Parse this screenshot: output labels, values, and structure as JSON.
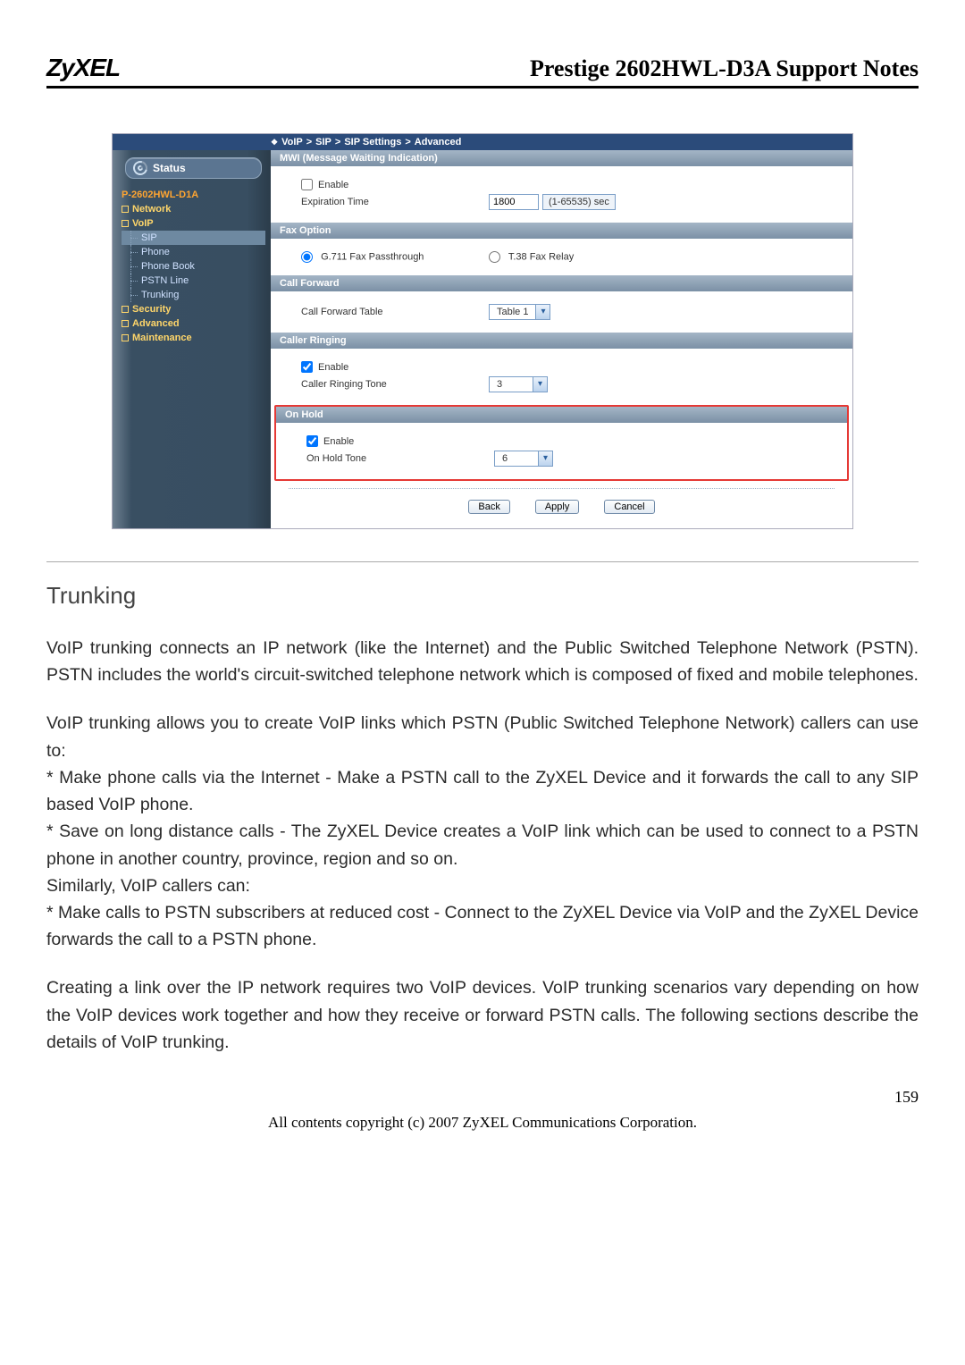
{
  "header": {
    "logo": "ZyXEL",
    "title": "Prestige 2602HWL-D3A Support Notes"
  },
  "breadcrumb": {
    "root": "VoIP",
    "l2": "SIP",
    "l3": "SIP Settings",
    "l4": "Advanced"
  },
  "sidebar": {
    "status": "Status",
    "device": "P-2602HWL-D1A",
    "groups": {
      "network": "Network",
      "voip": "VoIP",
      "security": "Security",
      "advanced": "Advanced",
      "maintenance": "Maintenance"
    },
    "voip_items": {
      "sip": "SIP",
      "phone": "Phone",
      "phonebook": "Phone Book",
      "pstn": "PSTN Line",
      "trunking": "Trunking"
    }
  },
  "sections": {
    "mwi": {
      "title": "MWI (Message Waiting Indication)",
      "enable": "Enable",
      "exp_label": "Expiration Time",
      "exp_value": "1800",
      "exp_unit": "(1-65535) sec"
    },
    "fax": {
      "title": "Fax Option",
      "opt1": "G.711 Fax Passthrough",
      "opt2": "T.38 Fax Relay"
    },
    "cf": {
      "title": "Call Forward",
      "label": "Call Forward Table",
      "value": "Table 1"
    },
    "ring": {
      "title": "Caller Ringing",
      "enable": "Enable",
      "tone_label": "Caller Ringing Tone",
      "tone_value": "3"
    },
    "hold": {
      "title": "On Hold",
      "enable": "Enable",
      "tone_label": "On Hold Tone",
      "tone_value": "6"
    },
    "buttons": {
      "back": "Back",
      "apply": "Apply",
      "cancel": "Cancel"
    }
  },
  "doc": {
    "h2": "Trunking",
    "p1": "VoIP trunking connects an IP network (like the Internet) and the Public Switched Telephone Network (PSTN). PSTN includes the world's circuit-switched telephone network which is composed of fixed and mobile telephones.",
    "p2": "VoIP trunking allows you to create VoIP links which PSTN (Public Switched Telephone Network) callers can use to:",
    "p3": "* Make phone calls via the Internet - Make a PSTN call to the ZyXEL Device and it forwards the call to any SIP based VoIP phone.",
    "p4": "* Save on long distance calls - The ZyXEL Device creates a VoIP link which can be used to connect to a PSTN phone in another country, province, region and so on.",
    "p5": "Similarly, VoIP callers can:",
    "p6": "* Make calls to PSTN subscribers at reduced cost - Connect to the ZyXEL Device via VoIP and the ZyXEL Device forwards the call to a PSTN phone.",
    "p7": "Creating a link over the IP network requires two VoIP devices. VoIP trunking scenarios vary depending on how the VoIP devices work together and how they receive or forward PSTN calls. The following sections describe the details of VoIP trunking.",
    "page_number": "159",
    "footer": "All contents copyright (c) 2007 ZyXEL Communications Corporation."
  }
}
